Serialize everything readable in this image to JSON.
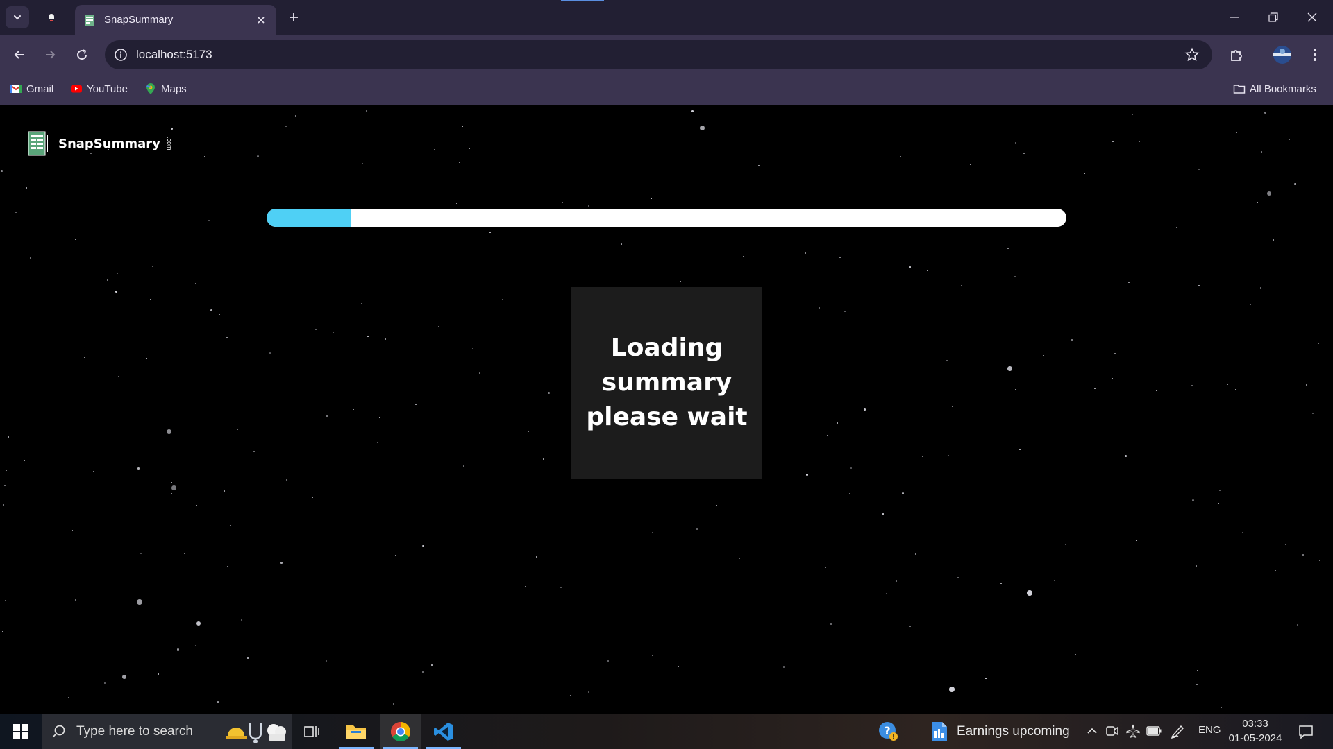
{
  "browser": {
    "tab_title": "SnapSummary",
    "url": "localhost:5173",
    "bookmarks": [
      {
        "label": "Gmail",
        "icon": "gmail-icon"
      },
      {
        "label": "YouTube",
        "icon": "youtube-icon"
      },
      {
        "label": "Maps",
        "icon": "maps-icon"
      }
    ],
    "all_bookmarks_label": "All Bookmarks"
  },
  "page": {
    "logo_text": "SnapSummary",
    "logo_tld": ".com",
    "progress_fraction": 0.105,
    "loading_lines": [
      "Loading",
      "summary",
      "please wait"
    ]
  },
  "taskbar": {
    "search_placeholder": "Type here to search",
    "news_label": "Earnings upcoming",
    "language": "ENG",
    "time": "03:33",
    "date": "01-05-2024"
  },
  "colors": {
    "progress_fill": "#4fd0f5",
    "progress_track": "#ffffff",
    "card_bg": "#1c1c1c",
    "chrome_bg": "#3b3450",
    "tabstrip_bg": "#221f33"
  }
}
